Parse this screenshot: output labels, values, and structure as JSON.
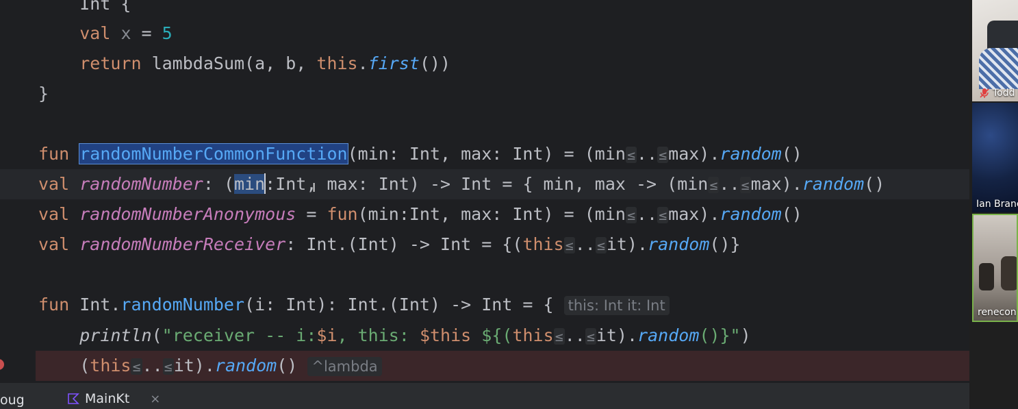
{
  "editor": {
    "lines": [
      [
        {
          "t": "    Int {",
          "c": ""
        }
      ],
      [
        {
          "t": "    ",
          "c": ""
        },
        {
          "t": "val",
          "c": "kw"
        },
        {
          "t": " ",
          "c": ""
        },
        {
          "t": "x",
          "c": "gray"
        },
        {
          "t": " = ",
          "c": ""
        },
        {
          "t": "5",
          "c": "num"
        }
      ],
      [
        {
          "t": "    ",
          "c": ""
        },
        {
          "t": "return",
          "c": "kw"
        },
        {
          "t": " lambdaSum(a, b, ",
          "c": ""
        },
        {
          "t": "this",
          "c": "kw"
        },
        {
          "t": ".",
          "c": ""
        },
        {
          "t": "first",
          "c": "fn it"
        },
        {
          "t": "())",
          "c": ""
        }
      ],
      [
        {
          "t": "}",
          "c": ""
        }
      ],
      [],
      [
        {
          "t": "fun",
          "c": "kw"
        },
        {
          "t": " ",
          "c": ""
        },
        {
          "t": "randomNumberCommonFunction",
          "c": "fn sel"
        },
        {
          "t": "(min: Int, max: Int) = (min",
          "c": ""
        },
        {
          "t": "≤",
          "c": "sym"
        },
        {
          "t": "..",
          "c": ""
        },
        {
          "t": "≤",
          "c": "sym"
        },
        {
          "t": "max).",
          "c": ""
        },
        {
          "t": "random",
          "c": "fn it"
        },
        {
          "t": "()",
          "c": ""
        }
      ],
      [
        {
          "t": "val",
          "c": "kw"
        },
        {
          "t": " ",
          "c": ""
        },
        {
          "t": "randomNumber",
          "c": "prop"
        },
        {
          "t": ": (",
          "c": ""
        },
        {
          "t": "min",
          "c": "occ"
        },
        {
          "t": "",
          "c": "caret"
        },
        {
          "t": ":Int, max: Int) -> Int = { min, max -> (min",
          "c": ""
        },
        {
          "t": "≤",
          "c": "sym"
        },
        {
          "t": "..",
          "c": ""
        },
        {
          "t": "≤",
          "c": "sym"
        },
        {
          "t": "max).",
          "c": ""
        },
        {
          "t": "random",
          "c": "fn it"
        },
        {
          "t": "()",
          "c": ""
        }
      ],
      [
        {
          "t": "val",
          "c": "kw"
        },
        {
          "t": " ",
          "c": ""
        },
        {
          "t": "randomNumberAnonymous",
          "c": "prop"
        },
        {
          "t": " = ",
          "c": ""
        },
        {
          "t": "fun",
          "c": "kw"
        },
        {
          "t": "(min:Int, max: Int) = (min",
          "c": ""
        },
        {
          "t": "≤",
          "c": "sym"
        },
        {
          "t": "..",
          "c": ""
        },
        {
          "t": "≤",
          "c": "sym"
        },
        {
          "t": "max).",
          "c": ""
        },
        {
          "t": "random",
          "c": "fn it"
        },
        {
          "t": "()",
          "c": ""
        }
      ],
      [
        {
          "t": "val",
          "c": "kw"
        },
        {
          "t": " ",
          "c": ""
        },
        {
          "t": "randomNumberReceiver",
          "c": "prop"
        },
        {
          "t": ": Int.(Int) -> Int = {(",
          "c": ""
        },
        {
          "t": "this",
          "c": "kw"
        },
        {
          "t": "≤",
          "c": "sym"
        },
        {
          "t": "..",
          "c": ""
        },
        {
          "t": "≤",
          "c": "sym"
        },
        {
          "t": "it).",
          "c": ""
        },
        {
          "t": "random",
          "c": "fn it"
        },
        {
          "t": "()}",
          "c": ""
        }
      ],
      [],
      [
        {
          "t": "fun",
          "c": "kw"
        },
        {
          "t": " Int.",
          "c": ""
        },
        {
          "t": "randomNumber",
          "c": "fn"
        },
        {
          "t": "(i: Int): Int.(Int) -> Int = { ",
          "c": ""
        },
        {
          "t": "this: Int it: Int",
          "c": "hint"
        }
      ],
      [
        {
          "t": "    ",
          "c": ""
        },
        {
          "t": "println",
          "c": "it"
        },
        {
          "t": "(",
          "c": ""
        },
        {
          "t": "\"receiver -- i:",
          "c": "str"
        },
        {
          "t": "$i",
          "c": "kw"
        },
        {
          "t": ", this: ",
          "c": "str"
        },
        {
          "t": "$this",
          "c": "kw"
        },
        {
          "t": " ${(",
          "c": "str"
        },
        {
          "t": "this",
          "c": "kw"
        },
        {
          "t": "≤",
          "c": "sym"
        },
        {
          "t": "..",
          "c": ""
        },
        {
          "t": "≤",
          "c": "sym"
        },
        {
          "t": "it).",
          "c": ""
        },
        {
          "t": "random",
          "c": "fn it"
        },
        {
          "t": "()}\"",
          "c": "str"
        },
        {
          "t": ")",
          "c": ""
        }
      ],
      [
        {
          "t": "    (",
          "c": ""
        },
        {
          "t": "this",
          "c": "kw"
        },
        {
          "t": "≤",
          "c": "sym"
        },
        {
          "t": "..",
          "c": ""
        },
        {
          "t": "≤",
          "c": "sym"
        },
        {
          "t": "it).",
          "c": ""
        },
        {
          "t": "random",
          "c": "fn it"
        },
        {
          "t": "() ",
          "c": ""
        },
        {
          "t": "^lambda",
          "c": "hint"
        }
      ]
    ]
  },
  "bottom": {
    "debug_label": "oug",
    "tab_label": "MainKt",
    "tab_close": "×"
  },
  "participants": [
    {
      "name": "Todd I",
      "muted": true
    },
    {
      "name": "Ian Branc"
    },
    {
      "name": "renecont"
    }
  ],
  "colors": {
    "editor_bg": "#1e1f22",
    "keyword": "#cf8e6d",
    "function": "#56a8f5",
    "property": "#c77dbb",
    "string": "#6aab73",
    "number": "#2aacb8",
    "breakpoint": "#c94f4f"
  }
}
